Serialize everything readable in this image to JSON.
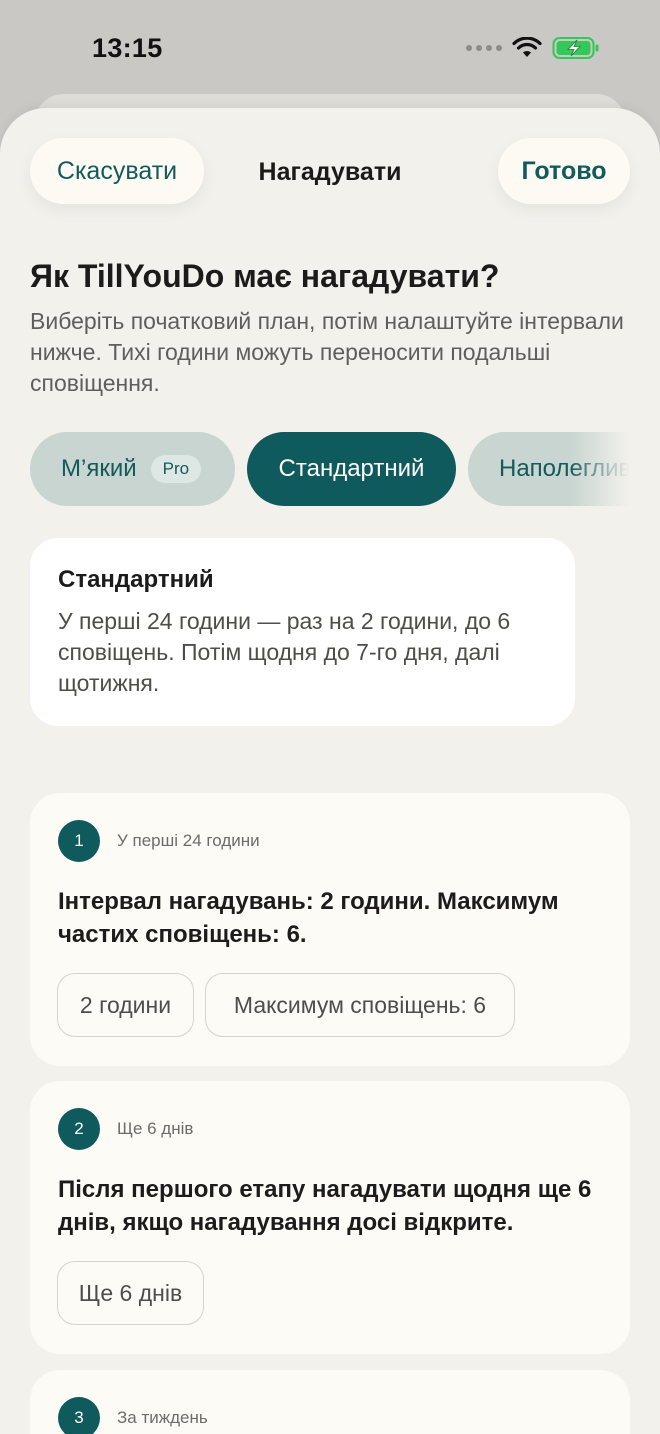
{
  "status_bar": {
    "time": "13:15",
    "battery_color": "#34c759"
  },
  "header": {
    "cancel_label": "Скасувати",
    "title": "Нагадувати",
    "done_label": "Готово"
  },
  "intro": {
    "title": "Як TillYouDo має нагадувати?",
    "subtitle": "Виберіть початковий план, потім налаштуйте інтервали нижче. Тихі години можуть переносити подальші сповіщення."
  },
  "presets": [
    {
      "label": "М’який",
      "badge": "Pro",
      "selected": false
    },
    {
      "label": "Стандартний",
      "selected": true
    },
    {
      "label": "Наполегливий",
      "selected": false
    }
  ],
  "summary": {
    "title": "Стандартний",
    "text": "У перші 24 години — раз на 2 години, до 6 сповіщень. Потім щодня до 7-го дня, далі щотижня."
  },
  "steps": [
    {
      "number": "1",
      "label": "У перші 24 години",
      "description": "Інтервал нагадувань: 2 години. Максимум частих сповіщень: 6.",
      "chips": [
        "2 години",
        "Максимум сповіщень: 6"
      ]
    },
    {
      "number": "2",
      "label": "Ще 6 днів",
      "description": "Після першого етапу нагадувати щодня ще 6 днів, якщо нагадування досі відкрите.",
      "chips": [
        "Ще 6 днів"
      ]
    },
    {
      "number": "3",
      "label": "За тиждень"
    }
  ],
  "colors": {
    "accent": "#0f5a5c",
    "accent_text": "#135a5c",
    "sheet_bg": "#f3f1ec",
    "card_bg": "#fcfbf6"
  }
}
